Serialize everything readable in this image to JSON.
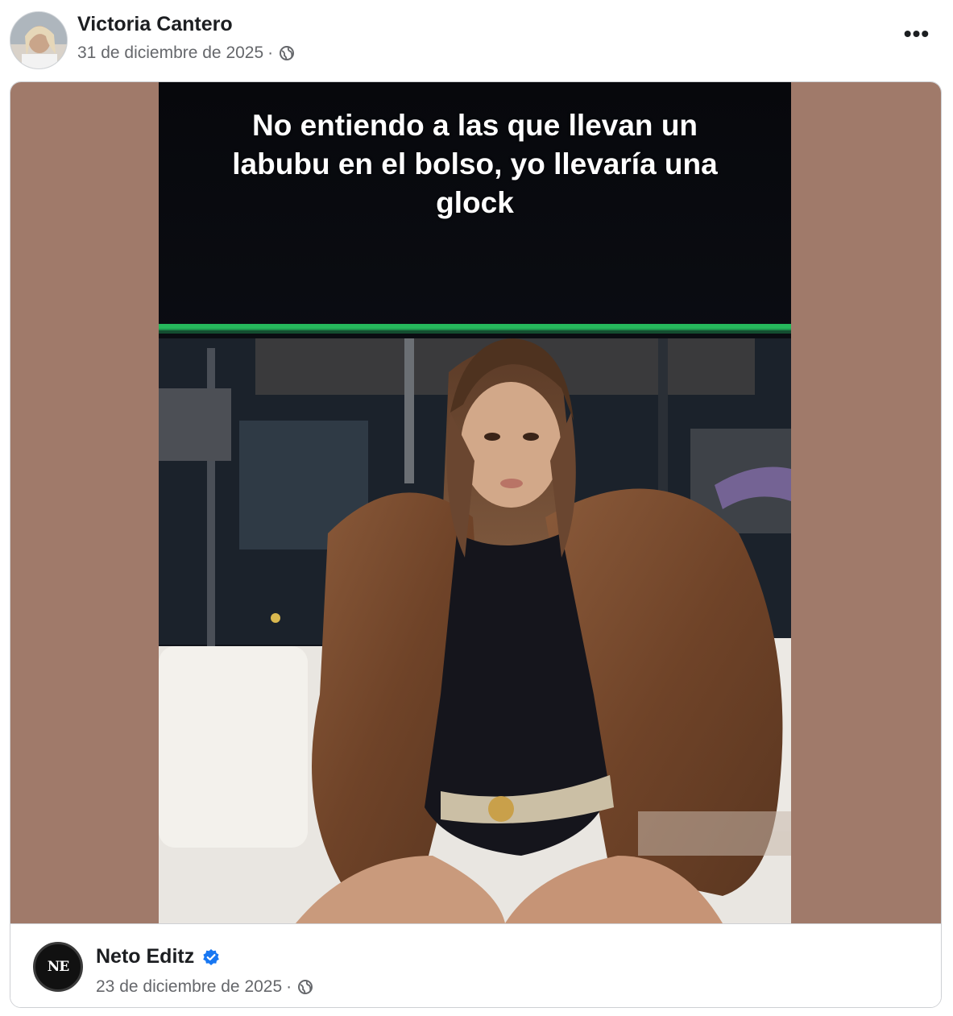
{
  "post": {
    "author": "Victoria Cantero",
    "date": "31 de diciembre de 2025",
    "separator": "·",
    "privacy_icon": "globe-icon",
    "more_label": "•••"
  },
  "shared": {
    "caption": "No entiendo a las que llevan un labubu en el bolso, yo llevaría una glock",
    "page_name": "Neto Editz",
    "page_avatar_text": "NE",
    "verified_icon": "verified-badge-icon",
    "date": "23 de diciembre de 2025",
    "separator": "·",
    "privacy_icon": "globe-icon"
  },
  "colors": {
    "letterbox": "#a07a6a",
    "meta_text": "#65676b",
    "verified": "#1877f2",
    "neon": "#2bd86a"
  }
}
